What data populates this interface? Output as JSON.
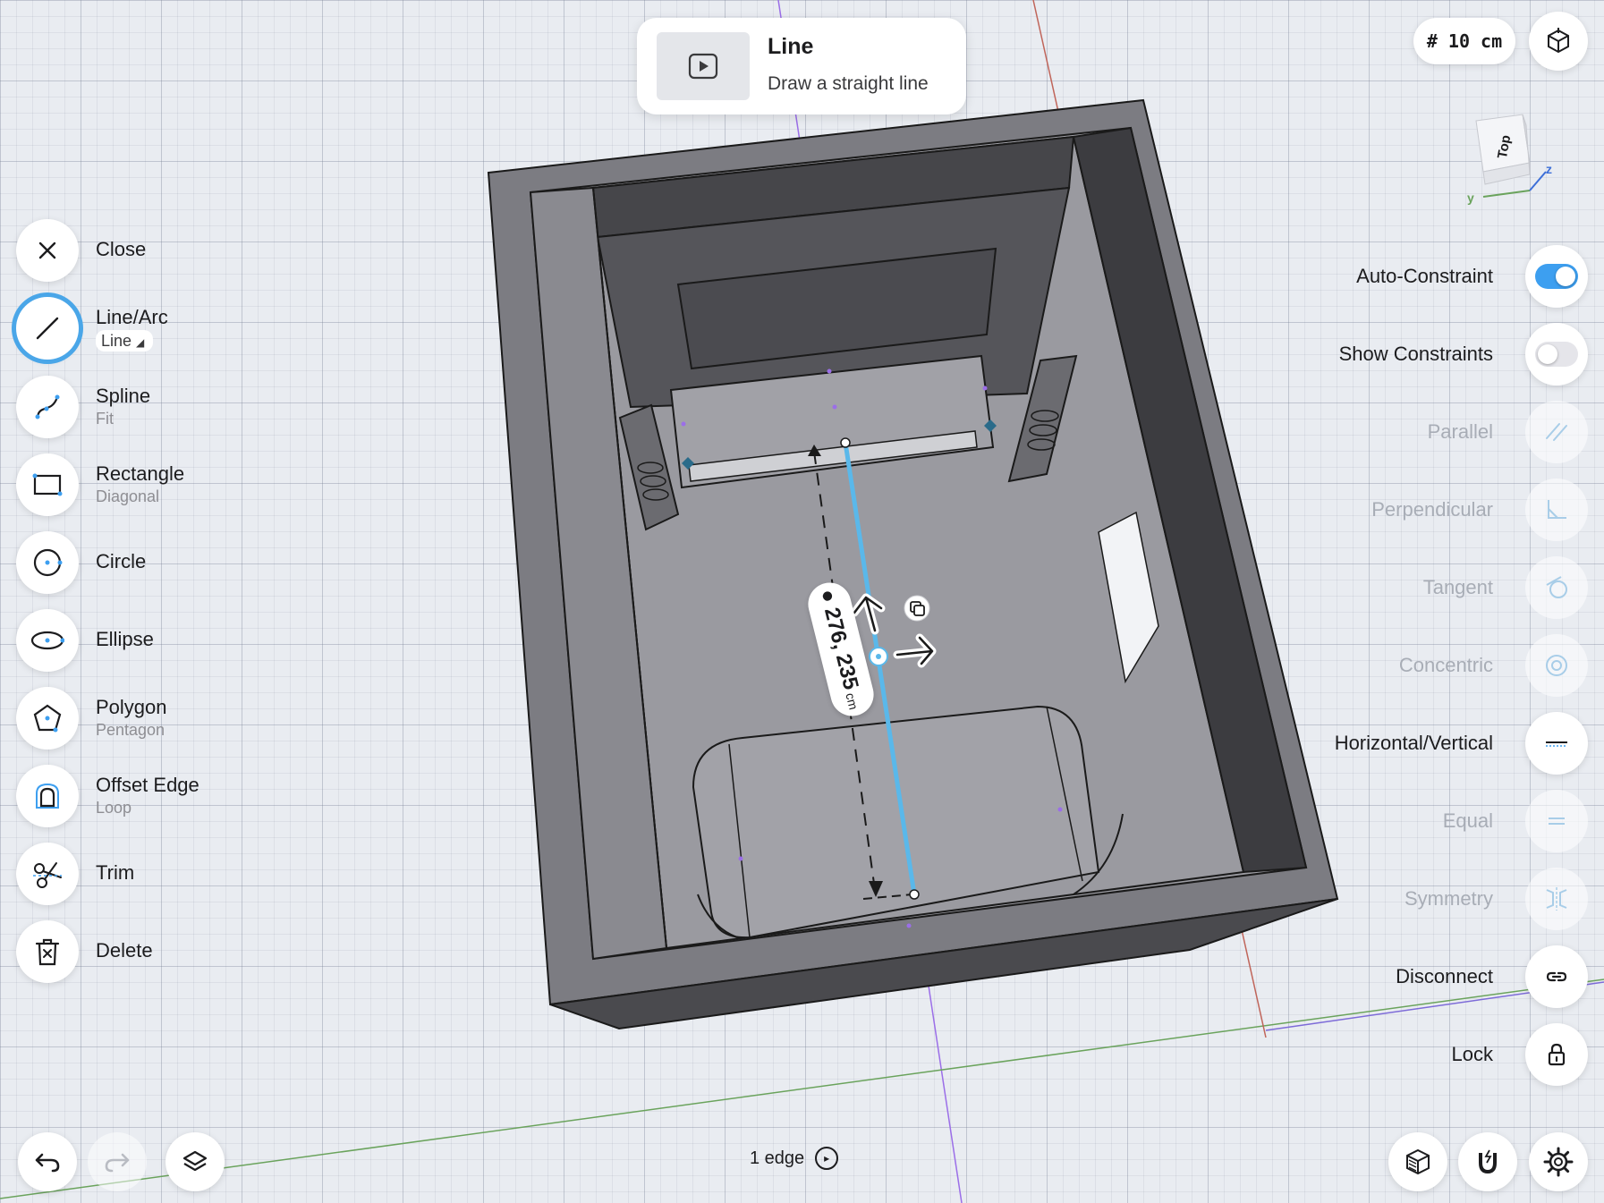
{
  "tooltip": {
    "title": "Line",
    "description": "Draw a straight line",
    "thumbnail_icon": "play-icon"
  },
  "grid": {
    "label": "# 10 cm"
  },
  "view_cube": {
    "face": "Top",
    "axis_y": "y",
    "axis_z": "z"
  },
  "tools": [
    {
      "name": "close",
      "label": "Close",
      "sub": "",
      "icon": "close-icon"
    },
    {
      "name": "line-arc",
      "label": "Line/Arc",
      "sub": "Line",
      "icon": "line-icon",
      "active": true
    },
    {
      "name": "spline",
      "label": "Spline",
      "sub": "Fit",
      "icon": "spline-icon"
    },
    {
      "name": "rectangle",
      "label": "Rectangle",
      "sub": "Diagonal",
      "icon": "rectangle-icon"
    },
    {
      "name": "circle",
      "label": "Circle",
      "sub": "",
      "icon": "circle-icon"
    },
    {
      "name": "ellipse",
      "label": "Ellipse",
      "sub": "",
      "icon": "ellipse-icon"
    },
    {
      "name": "polygon",
      "label": "Polygon",
      "sub": "Pentagon",
      "icon": "polygon-icon"
    },
    {
      "name": "offset-edge",
      "label": "Offset Edge",
      "sub": "Loop",
      "icon": "offset-edge-icon"
    },
    {
      "name": "trim",
      "label": "Trim",
      "sub": "",
      "icon": "scissors-icon"
    },
    {
      "name": "delete",
      "label": "Delete",
      "sub": "",
      "icon": "trash-icon"
    }
  ],
  "constraints": {
    "auto_constraint": {
      "label": "Auto-Constraint",
      "on": true
    },
    "show_constraints": {
      "label": "Show Constraints",
      "on": false
    },
    "parallel": "Parallel",
    "perpendicular": "Perpendicular",
    "tangent": "Tangent",
    "concentric": "Concentric",
    "horizontal_vertical": "Horizontal/Vertical",
    "equal": "Equal",
    "symmetry": "Symmetry",
    "disconnect": "Disconnect",
    "lock": "Lock"
  },
  "dimension": {
    "value": "276, 235",
    "unit": "cm"
  },
  "status": {
    "selection": "1 edge"
  },
  "colors": {
    "accent": "#3d9ff0",
    "sketch_line": "#5ab8ea",
    "model_gray": "#8e8e93",
    "axis_purple": "#9b6ee8",
    "axis_red": "#c0655a",
    "axis_green": "#6aa35c"
  }
}
